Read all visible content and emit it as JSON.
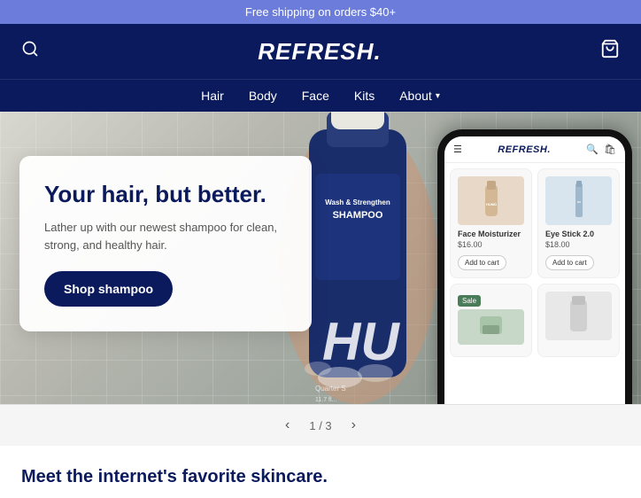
{
  "promo": {
    "text": "Free shipping on orders $40+"
  },
  "header": {
    "logo": "REFRESH.",
    "search_icon": "search",
    "cart_icon": "cart"
  },
  "nav": {
    "items": [
      {
        "label": "Hair",
        "has_dropdown": false
      },
      {
        "label": "Body",
        "has_dropdown": false
      },
      {
        "label": "Face",
        "has_dropdown": false
      },
      {
        "label": "Kits",
        "has_dropdown": false
      },
      {
        "label": "About",
        "has_dropdown": true
      }
    ]
  },
  "hero": {
    "title": "Your hair, but better.",
    "subtitle": "Lather up with our newest shampoo for clean, strong, and healthy hair.",
    "cta_label": "Shop shampoo",
    "pagination": {
      "current": "1",
      "total": "3"
    }
  },
  "phone": {
    "logo": "REFRESH.",
    "products": [
      {
        "name": "Face Moisturizer",
        "price": "$16.00",
        "add_label": "Add to cart",
        "sale": false,
        "color": "#e8d8c8"
      },
      {
        "name": "Eye Stick 2.0",
        "price": "$18.00",
        "add_label": "Add to cart",
        "sale": false,
        "color": "#d8e8f0"
      },
      {
        "name": "",
        "price": "",
        "add_label": "",
        "sale": true,
        "color": "#c8d8c8"
      },
      {
        "name": "",
        "price": "",
        "add_label": "",
        "sale": false,
        "color": "#e8e8e8"
      }
    ],
    "sale_label": "Sale"
  },
  "section": {
    "title": "Meet the internet's favorite skincare."
  }
}
